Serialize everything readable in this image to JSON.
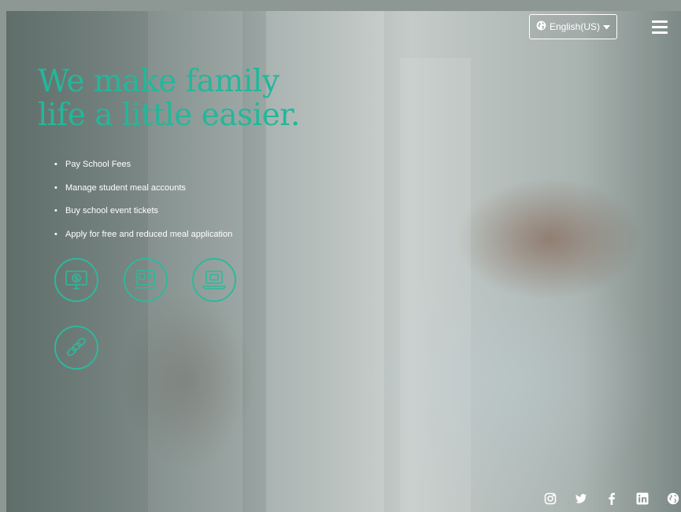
{
  "header": {
    "language_label": "English(US)",
    "menu_icon": "hamburger-menu-icon"
  },
  "hero": {
    "headline_line1": "We make family",
    "headline_line2": "life a little easier.",
    "features": [
      "Pay School Fees",
      "Manage student meal accounts",
      "Buy school event tickets",
      "Apply for free and reduced meal application"
    ]
  },
  "service_icons": [
    "school-fees-monitor-icon",
    "meal-account-card-icon",
    "event-ticket-laptop-icon",
    "meal-application-coins-icon"
  ],
  "social_links": [
    "instagram-icon",
    "twitter-icon",
    "facebook-icon",
    "linkedin-icon",
    "globe-icon"
  ],
  "colors": {
    "accent": "#23b79a",
    "text_light": "#ffffff"
  }
}
